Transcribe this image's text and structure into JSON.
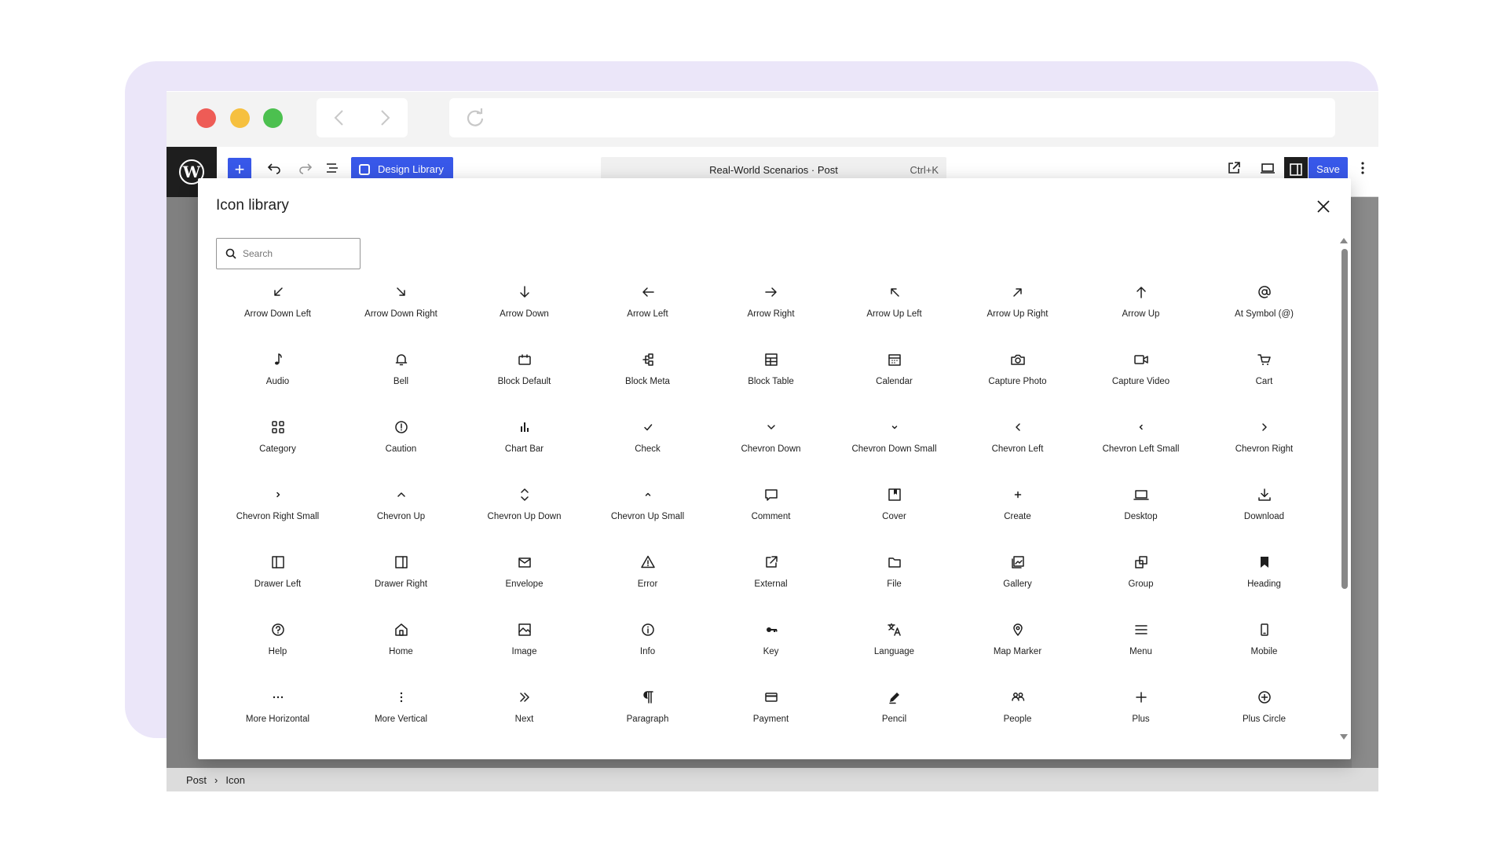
{
  "browser": {
    "back_icon": "chevron-left-icon",
    "forward_icon": "chevron-right-icon",
    "reload_icon": "reload-icon"
  },
  "editor": {
    "design_library_label": "Design Library",
    "document_title": "Real-World Scenarios · Post",
    "shortcut": "Ctrl+K",
    "save_label": "Save",
    "breadcrumb": [
      "Post",
      "Icon"
    ]
  },
  "modal": {
    "title": "Icon library",
    "search_placeholder": "Search",
    "icons": [
      {
        "label": "Arrow Down Left",
        "icon": "arrow-down-left-icon"
      },
      {
        "label": "Arrow Down Right",
        "icon": "arrow-down-right-icon"
      },
      {
        "label": "Arrow Down",
        "icon": "arrow-down-icon"
      },
      {
        "label": "Arrow Left",
        "icon": "arrow-left-icon"
      },
      {
        "label": "Arrow Right",
        "icon": "arrow-right-icon"
      },
      {
        "label": "Arrow Up Left",
        "icon": "arrow-up-left-icon"
      },
      {
        "label": "Arrow Up Right",
        "icon": "arrow-up-right-icon"
      },
      {
        "label": "Arrow Up",
        "icon": "arrow-up-icon"
      },
      {
        "label": "At Symbol (@)",
        "icon": "at-symbol-icon"
      },
      {
        "label": "Audio",
        "icon": "audio-icon"
      },
      {
        "label": "Bell",
        "icon": "bell-icon"
      },
      {
        "label": "Block Default",
        "icon": "block-default-icon"
      },
      {
        "label": "Block Meta",
        "icon": "block-meta-icon"
      },
      {
        "label": "Block Table",
        "icon": "block-table-icon"
      },
      {
        "label": "Calendar",
        "icon": "calendar-icon"
      },
      {
        "label": "Capture Photo",
        "icon": "capture-photo-icon"
      },
      {
        "label": "Capture Video",
        "icon": "capture-video-icon"
      },
      {
        "label": "Cart",
        "icon": "cart-icon"
      },
      {
        "label": "Category",
        "icon": "category-icon"
      },
      {
        "label": "Caution",
        "icon": "caution-icon"
      },
      {
        "label": "Chart Bar",
        "icon": "chart-bar-icon"
      },
      {
        "label": "Check",
        "icon": "check-icon"
      },
      {
        "label": "Chevron Down",
        "icon": "chevron-down-icon"
      },
      {
        "label": "Chevron Down Small",
        "icon": "chevron-down-small-icon"
      },
      {
        "label": "Chevron Left",
        "icon": "chevron-left-icon"
      },
      {
        "label": "Chevron Left Small",
        "icon": "chevron-left-small-icon"
      },
      {
        "label": "Chevron Right",
        "icon": "chevron-right-icon"
      },
      {
        "label": "Chevron Right Small",
        "icon": "chevron-right-small-icon"
      },
      {
        "label": "Chevron Up",
        "icon": "chevron-up-icon"
      },
      {
        "label": "Chevron Up Down",
        "icon": "chevron-up-down-icon"
      },
      {
        "label": "Chevron Up Small",
        "icon": "chevron-up-small-icon"
      },
      {
        "label": "Comment",
        "icon": "comment-icon"
      },
      {
        "label": "Cover",
        "icon": "cover-icon"
      },
      {
        "label": "Create",
        "icon": "create-icon"
      },
      {
        "label": "Desktop",
        "icon": "desktop-icon"
      },
      {
        "label": "Download",
        "icon": "download-icon"
      },
      {
        "label": "Drawer Left",
        "icon": "drawer-left-icon"
      },
      {
        "label": "Drawer Right",
        "icon": "drawer-right-icon"
      },
      {
        "label": "Envelope",
        "icon": "envelope-icon"
      },
      {
        "label": "Error",
        "icon": "error-icon"
      },
      {
        "label": "External",
        "icon": "external-icon"
      },
      {
        "label": "File",
        "icon": "file-icon"
      },
      {
        "label": "Gallery",
        "icon": "gallery-icon"
      },
      {
        "label": "Group",
        "icon": "group-icon"
      },
      {
        "label": "Heading",
        "icon": "heading-icon"
      },
      {
        "label": "Help",
        "icon": "help-icon"
      },
      {
        "label": "Home",
        "icon": "home-icon"
      },
      {
        "label": "Image",
        "icon": "image-icon"
      },
      {
        "label": "Info",
        "icon": "info-icon"
      },
      {
        "label": "Key",
        "icon": "key-icon"
      },
      {
        "label": "Language",
        "icon": "language-icon"
      },
      {
        "label": "Map Marker",
        "icon": "map-marker-icon"
      },
      {
        "label": "Menu",
        "icon": "menu-icon"
      },
      {
        "label": "Mobile",
        "icon": "mobile-icon"
      },
      {
        "label": "More Horizontal",
        "icon": "more-horizontal-icon"
      },
      {
        "label": "More Vertical",
        "icon": "more-vertical-icon"
      },
      {
        "label": "Next",
        "icon": "next-icon"
      },
      {
        "label": "Paragraph",
        "icon": "paragraph-icon"
      },
      {
        "label": "Payment",
        "icon": "payment-icon"
      },
      {
        "label": "Pencil",
        "icon": "pencil-icon"
      },
      {
        "label": "People",
        "icon": "people-icon"
      },
      {
        "label": "Plus",
        "icon": "plus-icon"
      },
      {
        "label": "Plus Circle",
        "icon": "plus-circle-icon"
      }
    ]
  },
  "colors": {
    "accent": "#3858e9",
    "backdrop": "#ebe6f9",
    "text": "#1e1e1e"
  }
}
